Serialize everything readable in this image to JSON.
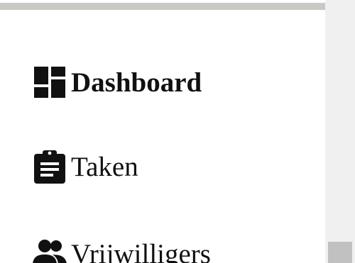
{
  "nav": {
    "items": [
      {
        "label": "Dashboard",
        "icon": "dashboard-icon",
        "active": true
      },
      {
        "label": "Taken",
        "icon": "clipboard-icon",
        "active": false
      },
      {
        "label": "Vrijwilligers",
        "icon": "people-icon",
        "active": false
      }
    ]
  },
  "colors": {
    "text": "#111111",
    "top_border": "#c9c9c3",
    "scrollbar_track": "#f0f0f0",
    "scrollbar_thumb": "#c1c1c1"
  }
}
